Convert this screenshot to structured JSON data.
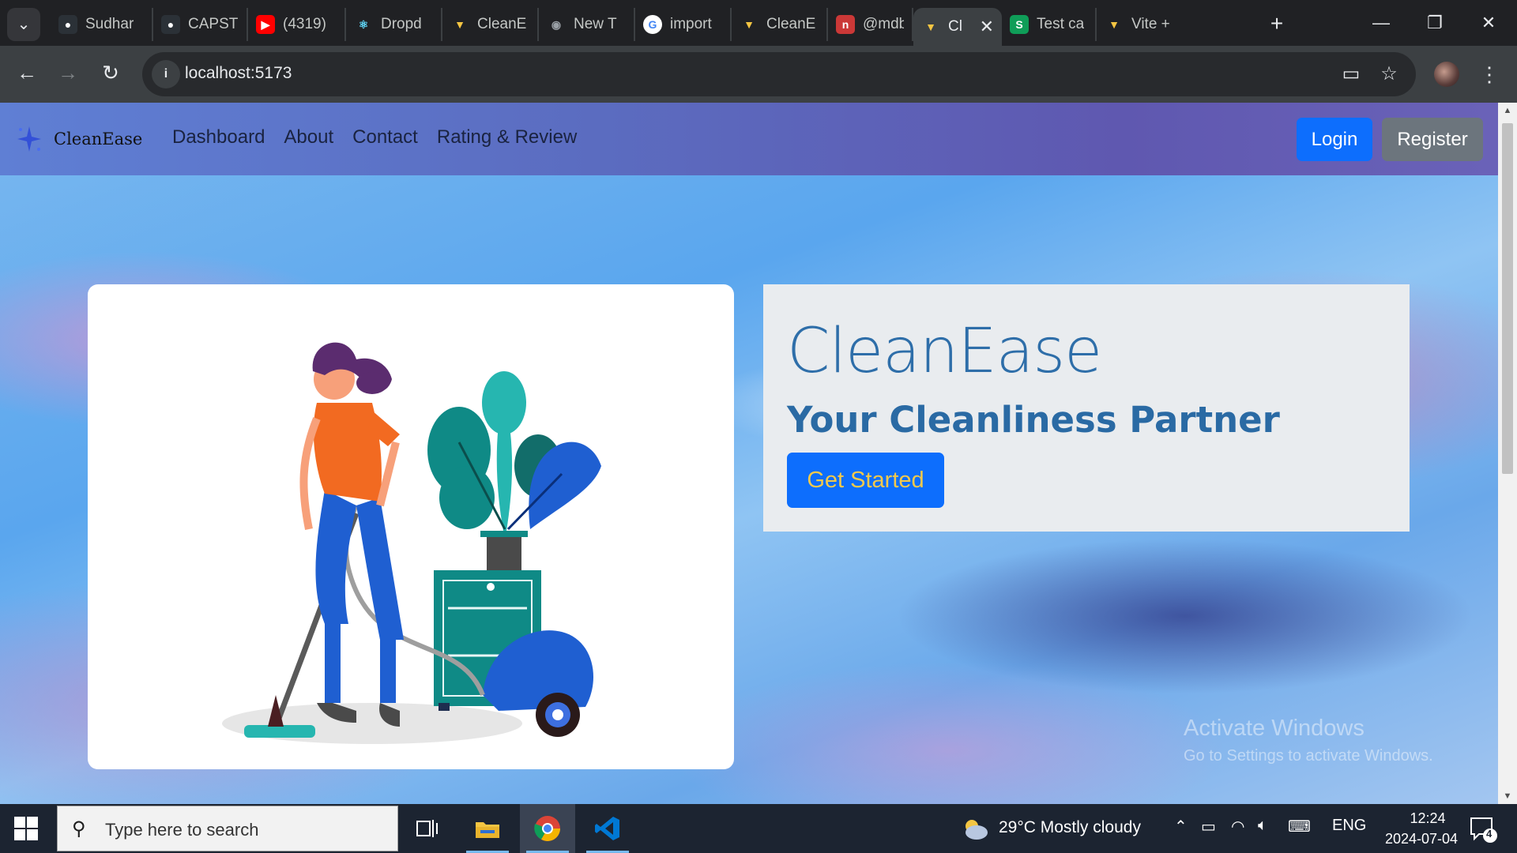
{
  "browser": {
    "tabs": [
      {
        "label": "Sudhar",
        "icon": "github-icon",
        "color": "#2b3137"
      },
      {
        "label": "CAPST",
        "icon": "github-icon",
        "color": "#2b3137"
      },
      {
        "label": "(4319)",
        "icon": "youtube-icon",
        "color": "#ff0000"
      },
      {
        "label": "Dropd",
        "icon": "react-bootstrap-icon",
        "color": "#61dafb"
      },
      {
        "label": "CleanE",
        "icon": "vite-icon",
        "color": "#bd34fe"
      },
      {
        "label": "New T",
        "icon": "chrome-icon",
        "color": "#9aa0a6"
      },
      {
        "label": "import",
        "icon": "google-icon",
        "color": "#4285f4"
      },
      {
        "label": "CleanE",
        "icon": "vite-icon",
        "color": "#bd34fe"
      },
      {
        "label": "@mdb",
        "icon": "npm-icon",
        "color": "#cb3837"
      },
      {
        "label": "Cl",
        "icon": "vite-icon",
        "color": "#bd34fe",
        "active": true,
        "close": "✕"
      },
      {
        "label": "Test ca",
        "icon": "sheets-icon",
        "color": "#0f9d58"
      },
      {
        "label": "Vite +",
        "icon": "vite-icon",
        "color": "#bd34fe"
      }
    ],
    "new_tab": "+",
    "url": "localhost:5173"
  },
  "site": {
    "brand": "CleanEase",
    "nav_links": [
      "Dashboard",
      "About",
      "Contact",
      "Rating & Review"
    ],
    "login_label": "Login",
    "register_label": "Register",
    "hero_title": "CleanEase",
    "hero_subtitle": "Your Cleanliness Partner",
    "cta_label": "Get Started",
    "colors": {
      "primary": "#0d6efd",
      "secondary": "#6c757d",
      "heading": "#2e6ea9",
      "cta_text": "#f2c94c"
    }
  },
  "watermark": {
    "title": "Activate Windows",
    "subtitle": "Go to Settings to activate Windows."
  },
  "taskbar": {
    "search_placeholder": "Type here to search",
    "weather_text": "29°C  Mostly cloudy",
    "language": "ENG",
    "time": "12:24",
    "date": "2024-07-04",
    "notification_count": "4"
  }
}
